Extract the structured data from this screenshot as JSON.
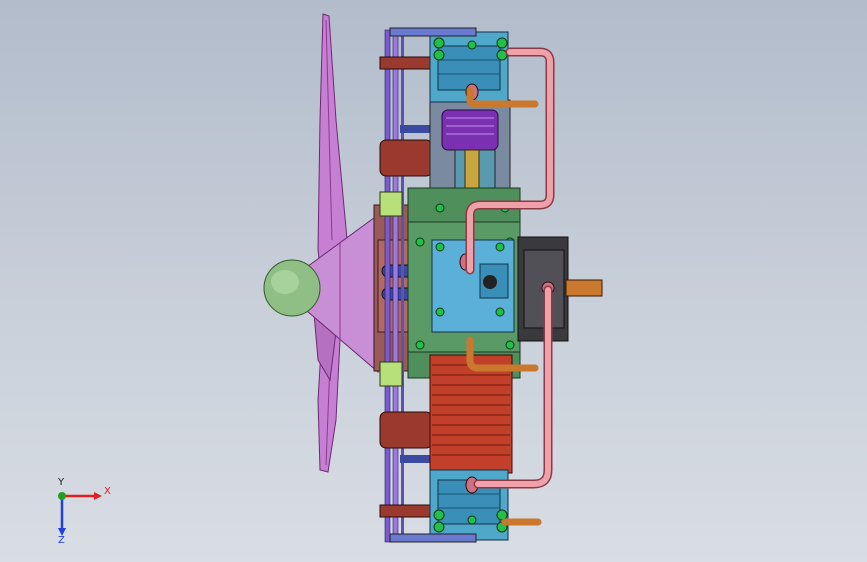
{
  "triad": {
    "x_label": "X",
    "y_label": "Y",
    "z_label": "Z"
  },
  "colors": {
    "background_top": "#b2bccb",
    "background_bottom": "#d9dde4",
    "propeller": "#c77fd4",
    "spinner": "#8fbf84",
    "crankcase": "#4f8f5c",
    "cylinder_head": "#4fa7c9",
    "cylinder_fins": "#c2402a",
    "pipe": "#f0a0a8",
    "bracket": "#9a3a2e",
    "nut": "#22c04a",
    "shaft": "#c9782e",
    "axis_x": "#e02020",
    "axis_y": "#20a020",
    "axis_z": "#2040e0"
  },
  "icons": {
    "triad": "coordinate-triad-icon"
  }
}
